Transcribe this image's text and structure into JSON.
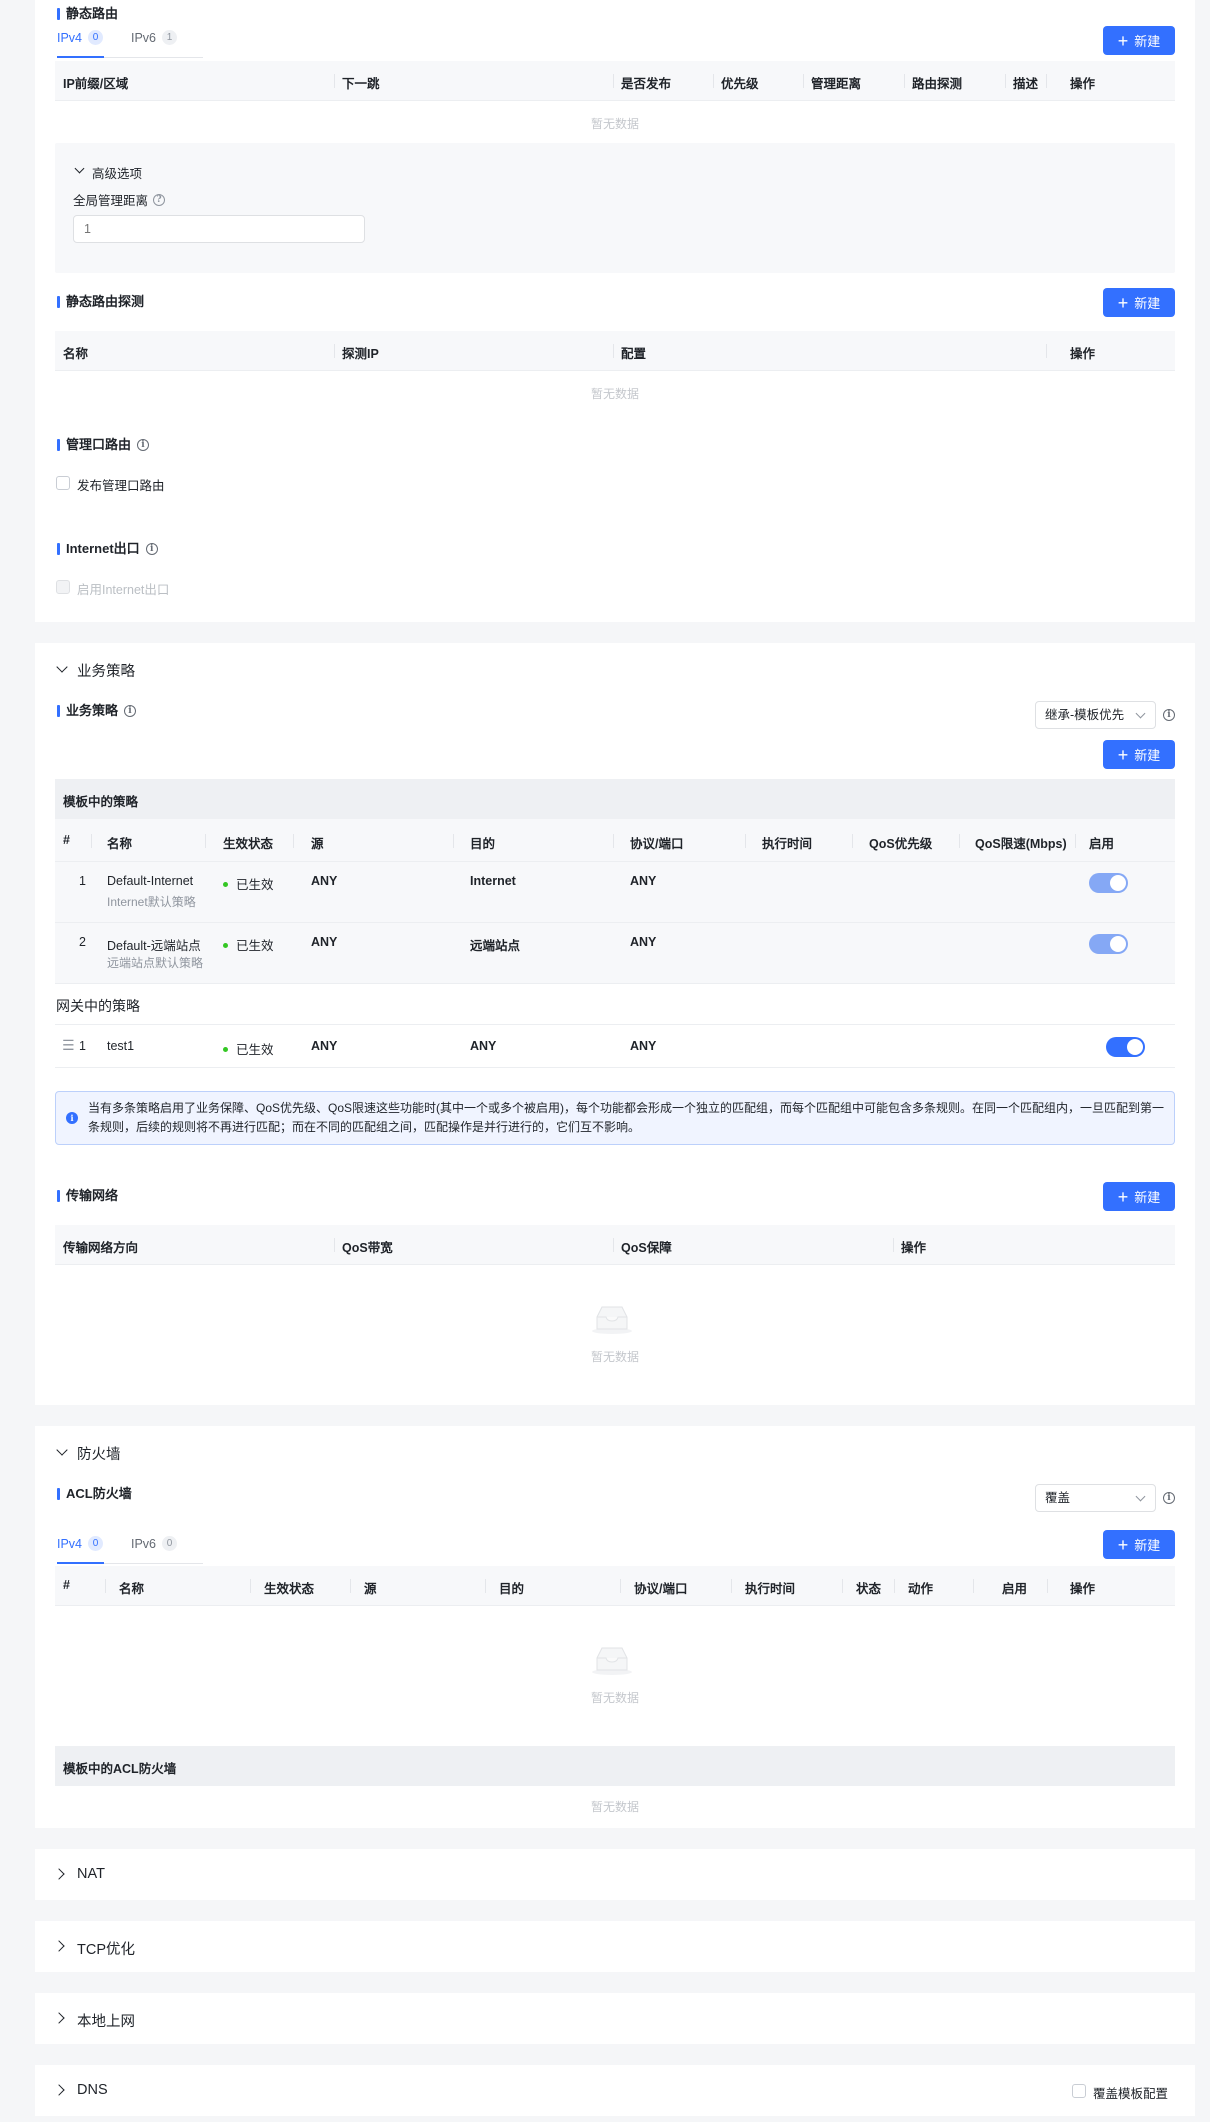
{
  "static_route": {
    "title": "静态路由",
    "tabs": [
      {
        "label": "IPv4",
        "count": "0"
      },
      {
        "label": "IPv6",
        "count": "1"
      }
    ],
    "new_button": "新建",
    "columns": [
      "IP前缀/区域",
      "下一跳",
      "是否发布",
      "优先级",
      "管理距离",
      "路由探测",
      "描述",
      "操作"
    ],
    "empty_text": "暂无数据",
    "advanced": {
      "toggle_label": "高级选项",
      "field_label": "全局管理距离",
      "field_placeholder": "1"
    }
  },
  "route_probe": {
    "title": "静态路由探测",
    "new_button": "新建",
    "columns": [
      "名称",
      "探测IP",
      "配置",
      "操作"
    ],
    "empty_text": "暂无数据"
  },
  "mgmt_route": {
    "title": "管理口路由",
    "checkbox_label": "发布管理口路由"
  },
  "internet_exit": {
    "title": "Internet出口",
    "checkbox_label": "启用Internet出口"
  },
  "biz_policy": {
    "section_label": "业务策略",
    "title": "业务策略",
    "select_value": "继承-模板优先",
    "new_button": "新建",
    "template_group_label": "模板中的策略",
    "columns": [
      "#",
      "名称",
      "生效状态",
      "源",
      "目的",
      "协议/端口",
      "执行时间",
      "QoS优先级",
      "QoS限速(Mbps)",
      "启用"
    ],
    "template_rows": [
      {
        "index": "1",
        "name": "Default-Internet",
        "desc": "Internet默认策略",
        "status": "已生效",
        "src": "ANY",
        "dst": "Internet",
        "proto": "ANY",
        "enabled": true
      },
      {
        "index": "2",
        "name": "Default-远端站点",
        "desc": "远端站点默认策略",
        "status": "已生效",
        "src": "ANY",
        "dst": "远端站点",
        "proto": "ANY",
        "enabled": true
      }
    ],
    "gateway_group_label": "网关中的策略",
    "gateway_rows": [
      {
        "index": "1",
        "name": "test1",
        "status": "已生效",
        "src": "ANY",
        "dst": "ANY",
        "proto": "ANY",
        "enabled": true
      }
    ],
    "notice": "当有多条策略启用了业务保障、QoS优先级、QoS限速这些功能时(其中一个或多个被启用)，每个功能都会形成一个独立的匹配组，而每个匹配组中可能包含多条规则。在同一个匹配组内，一旦匹配到第一条规则，后续的规则将不再进行匹配；而在不同的匹配组之间，匹配操作是并行进行的，它们互不影响。"
  },
  "transport": {
    "title": "传输网络",
    "new_button": "新建",
    "columns": [
      "传输网络方向",
      "QoS带宽",
      "QoS保障",
      "操作"
    ],
    "empty_text": "暂无数据"
  },
  "firewall": {
    "section_label": "防火墙",
    "title": "ACL防火墙",
    "select_value": "覆盖",
    "tabs": [
      {
        "label": "IPv4",
        "count": "0"
      },
      {
        "label": "IPv6",
        "count": "0"
      }
    ],
    "new_button": "新建",
    "columns": [
      "#",
      "名称",
      "生效状态",
      "源",
      "目的",
      "协议/端口",
      "执行时间",
      "状态",
      "动作",
      "启用",
      "操作"
    ],
    "empty_text": "暂无数据",
    "template_label": "模板中的ACL防火墙",
    "template_empty_text": "暂无数据"
  },
  "collapsed_sections": {
    "nat": "NAT",
    "tcp": "TCP优化",
    "local_internet": "本地上网",
    "dns": "DNS",
    "dns_override": "覆盖模板配置"
  },
  "colors": {
    "primary": "#3370ff",
    "success": "#34c724"
  }
}
